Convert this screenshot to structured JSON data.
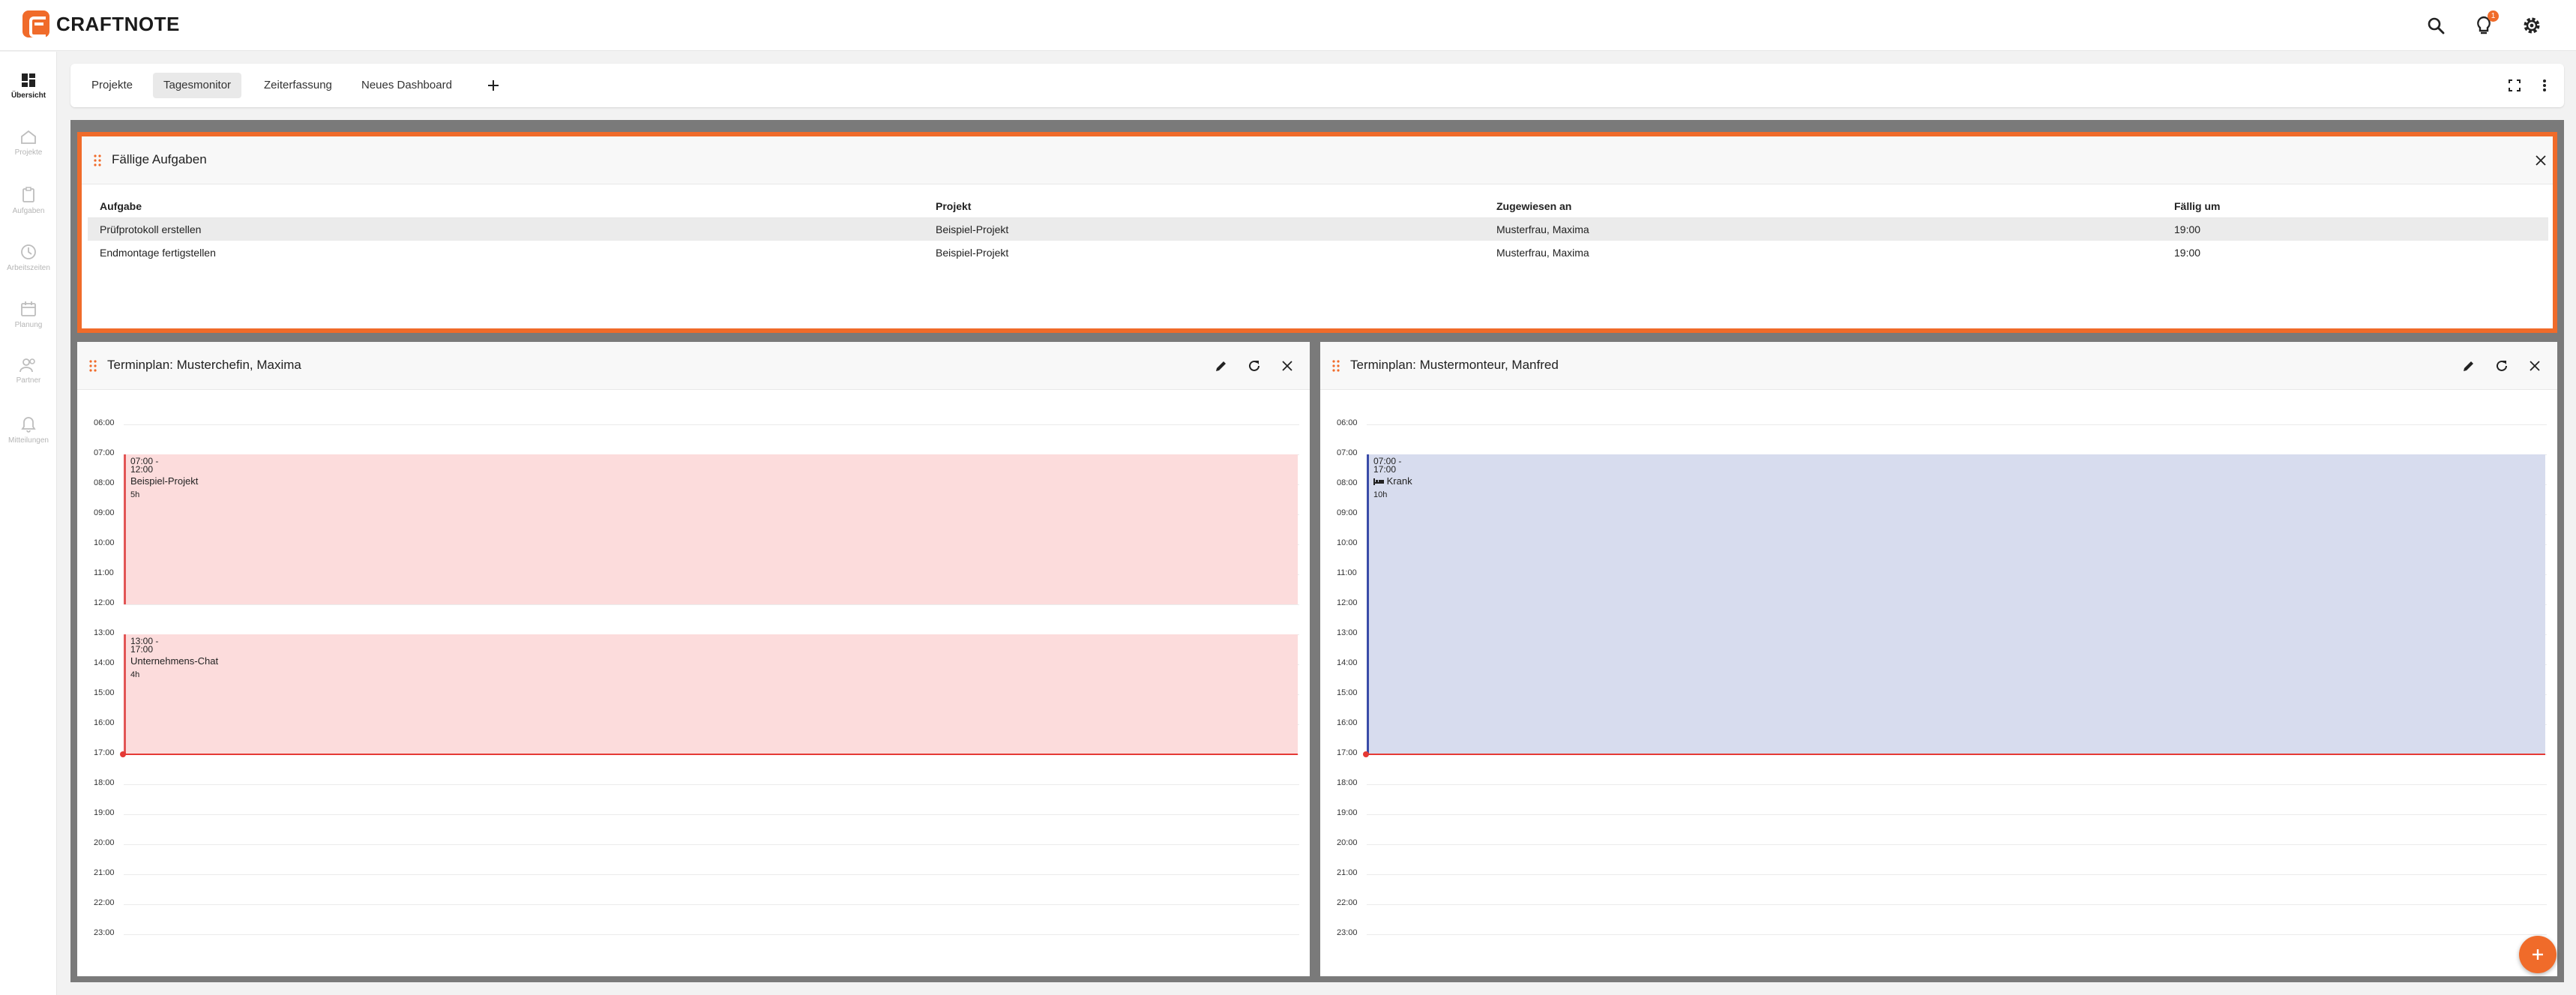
{
  "app": {
    "name": "CRAFTNOTE",
    "notification_count": "1"
  },
  "sidebar": {
    "items": [
      {
        "label": "Übersicht",
        "icon": "dashboard-icon",
        "active": true
      },
      {
        "label": "Projekte",
        "icon": "home-icon",
        "active": false
      },
      {
        "label": "Aufgaben",
        "icon": "clipboard-icon",
        "active": false
      },
      {
        "label": "Arbeitszeiten",
        "icon": "clock-icon",
        "active": false
      },
      {
        "label": "Planung",
        "icon": "calendar-icon",
        "active": false
      },
      {
        "label": "Partner",
        "icon": "people-icon",
        "active": false
      },
      {
        "label": "Mitteilungen",
        "icon": "bell-icon",
        "active": false
      }
    ]
  },
  "tabs": [
    {
      "label": "Projekte",
      "active": false
    },
    {
      "label": "Tagesmonitor",
      "active": true
    },
    {
      "label": "Zeiterfassung",
      "active": false
    },
    {
      "label": "Neues Dashboard",
      "active": false
    }
  ],
  "tasks_widget": {
    "title": "Fällige Aufgaben",
    "columns": [
      "Aufgabe",
      "Projekt",
      "Zugewiesen an",
      "Fällig um"
    ],
    "rows": [
      [
        "Prüfprotokoll erstellen",
        "Beispiel-Projekt",
        "Musterfrau, Maxima",
        "19:00"
      ],
      [
        "Endmontage fertigstellen",
        "Beispiel-Projekt",
        "Musterfrau, Maxima",
        "19:00"
      ]
    ]
  },
  "hours": [
    "06:00",
    "07:00",
    "08:00",
    "09:00",
    "10:00",
    "11:00",
    "12:00",
    "13:00",
    "14:00",
    "15:00",
    "16:00",
    "17:00",
    "18:00",
    "19:00",
    "20:00",
    "21:00",
    "22:00",
    "23:00"
  ],
  "schedules": [
    {
      "title": "Terminplan: Musterchefin, Maxima",
      "events": [
        {
          "time": "07:00 -\n12:00",
          "time_start": "07:00 -",
          "time_end": "12:00",
          "name": "Beispiel-Projekt",
          "duration": "5h",
          "color": "#fcdcdc"
        },
        {
          "time_start": "13:00 -",
          "time_end": "17:00",
          "name": "Unternehmens-Chat",
          "duration": "4h",
          "color": "#fcdcdc"
        }
      ]
    },
    {
      "title": "Terminplan: Mustermonteur, Manfred",
      "events": [
        {
          "time_start": "07:00 -",
          "time_end": "17:00",
          "name": "Krank",
          "duration": "10h",
          "color": "#d7dcee",
          "icon": "bed-icon"
        }
      ]
    }
  ],
  "colors": {
    "accent": "#f06b2a",
    "event_red": "#fcdcdc",
    "event_blue": "#d7dcee",
    "now_line": "#e53935"
  }
}
